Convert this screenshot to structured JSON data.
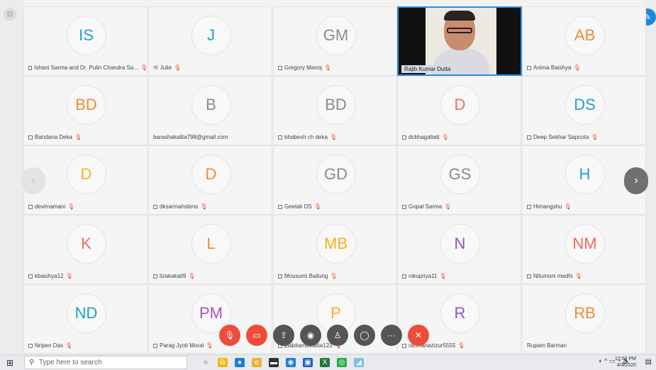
{
  "meeting": {
    "participants": [
      {
        "initials": "IS",
        "name": "Ishani Sarma and Dr. Pulin Chandra Sa...",
        "color": "#1ca2c9",
        "muted": true,
        "icon": "square"
      },
      {
        "initials": "J",
        "name": "Julie",
        "color": "#1ca2c9",
        "muted": true,
        "icon": "sync"
      },
      {
        "initials": "GM",
        "name": "Gregory Manoj",
        "color": "#8a8a8a",
        "muted": true,
        "icon": "square"
      },
      {
        "initials": "",
        "name": "Rajib Kumar Dutta",
        "color": "",
        "muted": false,
        "video": true,
        "icon": "square"
      },
      {
        "initials": "AB",
        "name": "Anima Baishya",
        "color": "#f08a36",
        "muted": true,
        "icon": "square"
      },
      {
        "initials": "BD",
        "name": "Bandana Deka",
        "color": "#f08a36",
        "muted": true,
        "icon": "square"
      },
      {
        "initials": "B",
        "name": "barashakalita798@gmail.com",
        "color": "#8a8a8a",
        "muted": false,
        "icon": "none"
      },
      {
        "initials": "BD",
        "name": "bhabesh ch deka",
        "color": "#8a8a8a",
        "muted": true,
        "icon": "square"
      },
      {
        "initials": "D",
        "name": "dcbhagabati",
        "color": "#ee6a5a",
        "muted": true,
        "icon": "square"
      },
      {
        "initials": "DS",
        "name": "Deep Sekhar Sapcota",
        "color": "#1ca2c9",
        "muted": true,
        "icon": "square"
      },
      {
        "initials": "D",
        "name": "devimamani",
        "color": "#f5b21c",
        "muted": true,
        "icon": "square"
      },
      {
        "initials": "D",
        "name": "dksarmahsbms",
        "color": "#f08a36",
        "muted": true,
        "icon": "square"
      },
      {
        "initials": "GD",
        "name": "Geetali DS",
        "color": "#8a8a8a",
        "muted": true,
        "icon": "square"
      },
      {
        "initials": "GS",
        "name": "Gopal Sarma",
        "color": "#8a8a8a",
        "muted": true,
        "icon": "square"
      },
      {
        "initials": "H",
        "name": "Himangshu",
        "color": "#1ca2c9",
        "muted": true,
        "icon": "square"
      },
      {
        "initials": "K",
        "name": "kbaishya12",
        "color": "#ee6a5a",
        "muted": true,
        "icon": "square"
      },
      {
        "initials": "L",
        "name": "lizakakati9",
        "color": "#f08a36",
        "muted": true,
        "icon": "square"
      },
      {
        "initials": "MB",
        "name": "Mousumi Bailung",
        "color": "#f5b21c",
        "muted": true,
        "icon": "square"
      },
      {
        "initials": "N",
        "name": "nikupriya11",
        "color": "#8b59b8",
        "muted": true,
        "icon": "square"
      },
      {
        "initials": "NM",
        "name": "Nitumoni medhi",
        "color": "#ee6a5a",
        "muted": true,
        "icon": "square"
      },
      {
        "initials": "ND",
        "name": "Nripen Das",
        "color": "#1ca2c9",
        "muted": true,
        "icon": "square"
      },
      {
        "initials": "PM",
        "name": "Parag Jyoti Moral",
        "color": "#b04fbf",
        "muted": true,
        "icon": "square"
      },
      {
        "initials": "P",
        "name": "plabitamilikalita123",
        "color": "#f5b21c",
        "muted": true,
        "icon": "square"
      },
      {
        "initials": "R",
        "name": "rahmanazizur5555",
        "color": "#8b59b8",
        "muted": true,
        "icon": "square"
      },
      {
        "initials": "RB",
        "name": "Rupam Barman",
        "color": "#f08a36",
        "muted": false,
        "icon": "none"
      }
    ]
  },
  "controls": [
    {
      "name": "mute-mic-button",
      "icon": "mic-off-icon",
      "glyph": "🎙",
      "style": "red"
    },
    {
      "name": "camera-off-button",
      "icon": "camera-off-icon",
      "glyph": "▭",
      "style": "red"
    },
    {
      "name": "share-screen-button",
      "icon": "share-icon",
      "glyph": "⇪",
      "style": "gray"
    },
    {
      "name": "record-button",
      "icon": "record-icon",
      "glyph": "◉",
      "style": "gray"
    },
    {
      "name": "participants-button",
      "icon": "people-icon",
      "glyph": "♙",
      "style": "gray"
    },
    {
      "name": "chat-button",
      "icon": "chat-icon",
      "glyph": "◯",
      "style": "gray"
    },
    {
      "name": "more-button",
      "icon": "ellipsis-icon",
      "glyph": "···",
      "style": "gray"
    },
    {
      "name": "leave-meeting-button",
      "icon": "close-icon",
      "glyph": "✕",
      "style": "red"
    }
  ],
  "taskbar": {
    "search_placeholder": "Type here to search",
    "time": "12:58 PM",
    "date": "4/4/2020",
    "apps": [
      "task-view",
      "chrome",
      "edge",
      "file-explorer",
      "store",
      "mail",
      "outlook",
      "excel",
      "webex",
      "paint"
    ]
  }
}
